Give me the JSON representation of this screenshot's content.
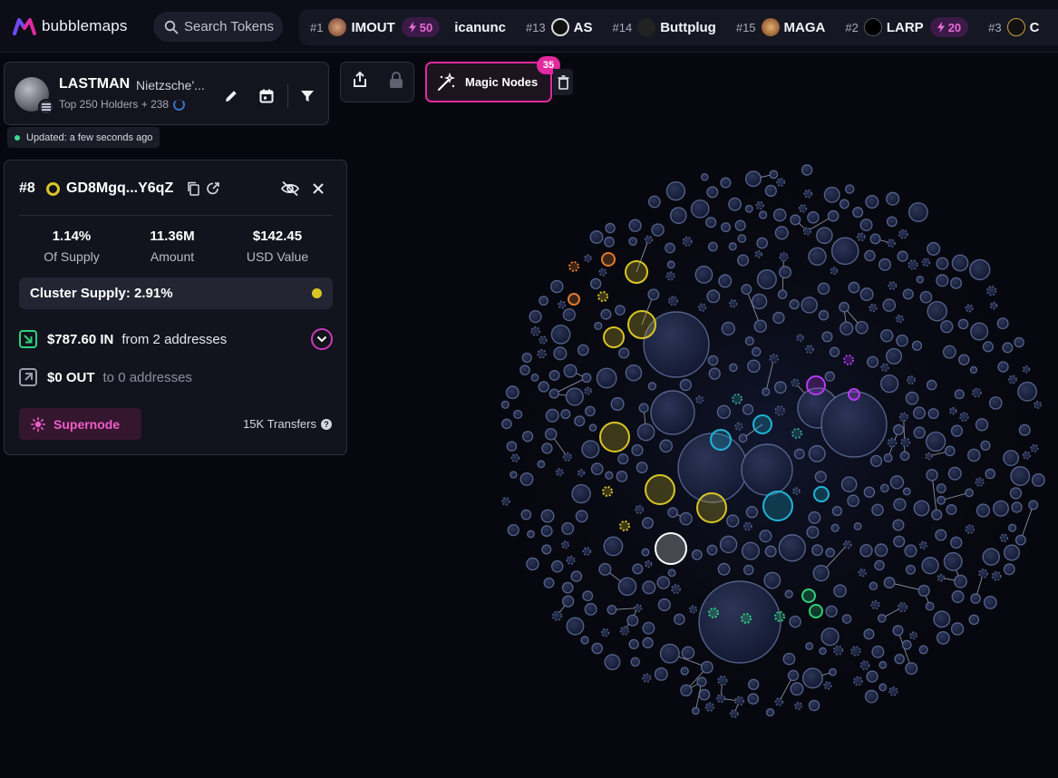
{
  "brand": {
    "name": "bubblemaps"
  },
  "search": {
    "placeholder": "Search Tokens"
  },
  "ticker": [
    {
      "rank": "#1",
      "name": "IMOUT",
      "boost": "50"
    },
    {
      "rank": "",
      "name": "icanunc",
      "boost": ""
    },
    {
      "rank": "#13",
      "name": "AS",
      "boost": ""
    },
    {
      "rank": "#14",
      "name": "Buttplug",
      "boost": ""
    },
    {
      "rank": "#15",
      "name": "MAGA",
      "boost": ""
    },
    {
      "rank": "#2",
      "name": "LARP",
      "boost": "20"
    },
    {
      "rank": "#3",
      "name": "C",
      "boost": ""
    }
  ],
  "token": {
    "symbol": "LASTMAN",
    "name": "Nietzsche'...",
    "holders": "Top 250 Holders + 238",
    "updated": "Updated: a few seconds ago"
  },
  "toolbar": {
    "magic_label": "Magic Nodes",
    "magic_count": "35"
  },
  "wallet": {
    "rank": "#8",
    "address": "GD8Mgq...Y6qZ",
    "stats": [
      {
        "value": "1.14%",
        "label": "Of Supply"
      },
      {
        "value": "11.36M",
        "label": "Amount"
      },
      {
        "value": "$142.45",
        "label": "USD Value"
      }
    ],
    "cluster_supply": "Cluster Supply: 2.91%",
    "in": {
      "amount": "$787.60 IN",
      "desc": "from 2 addresses"
    },
    "out": {
      "amount": "$0 OUT",
      "desc": "to 0 addresses"
    },
    "supernode_label": "Supernode",
    "transfers": "15K Transfers"
  },
  "colors": {
    "accent": "#e12a9d",
    "cluster_yellow": "#d9c526",
    "cluster_cyan": "#1fb5d6",
    "cluster_purple": "#b43cf0",
    "cluster_orange": "#e07a2a",
    "cluster_green": "#2fd07a",
    "bubble": "#6a7aa8"
  },
  "icons": [
    "search-icon",
    "edit-icon",
    "calendar-icon",
    "filter-icon",
    "share-icon",
    "lock-icon",
    "magic-wand-icon",
    "trash-icon",
    "copy-icon",
    "external-link-icon",
    "hide-icon",
    "close-icon",
    "arrow-in-icon",
    "arrow-out-icon",
    "chevron-down-icon",
    "sun-icon",
    "help-icon"
  ]
}
